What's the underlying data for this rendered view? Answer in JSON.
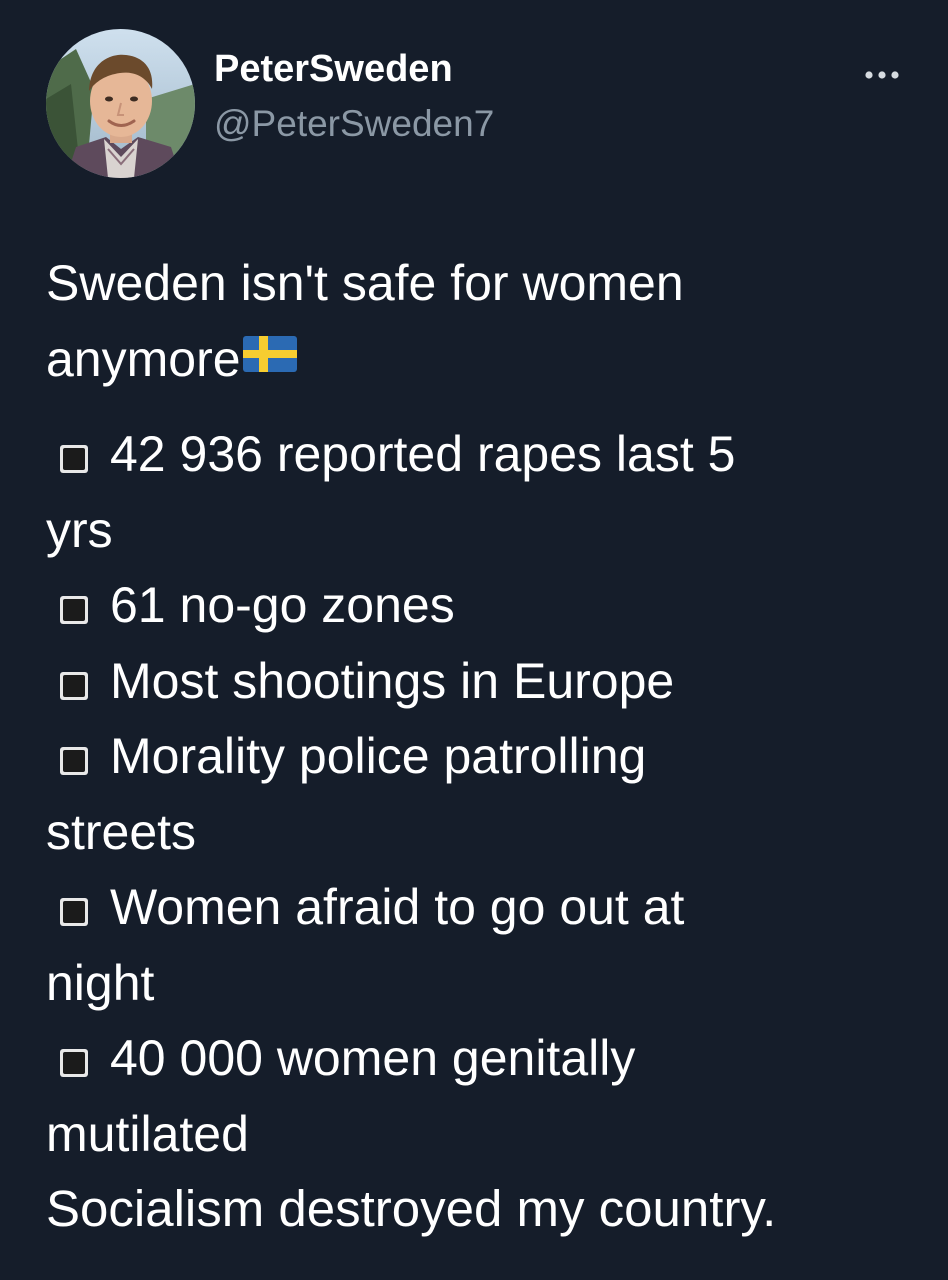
{
  "tweet": {
    "author": {
      "display_name": "PeterSweden",
      "handle": "@PeterSweden7",
      "avatar_icon": "profile-photo"
    },
    "more_icon": "more-horizontal-icon",
    "intro_line1": "Sweden isn't safe for women",
    "intro_line2": "anymore",
    "intro_emoji": "sweden-flag",
    "bullet_icon": "black-medium-small-square",
    "bullets": [
      {
        "line1": "42 936 reported rapes last 5",
        "line2": "yrs"
      },
      {
        "line1": "61 no-go zones",
        "line2": ""
      },
      {
        "line1": "Most shootings in Europe",
        "line2": ""
      },
      {
        "line1": "Morality police patrolling",
        "line2": "streets"
      },
      {
        "line1": "Women afraid to go out at",
        "line2": "night"
      },
      {
        "line1": "40 000 women genitally",
        "line2": "mutilated"
      }
    ],
    "closing": "Socialism destroyed my country."
  },
  "colors": {
    "background": "#151d2a",
    "text": "#ffffff",
    "secondary_text": "#8b98a5",
    "flag_blue": "#2b6ab3",
    "flag_yellow": "#f7cd30"
  }
}
